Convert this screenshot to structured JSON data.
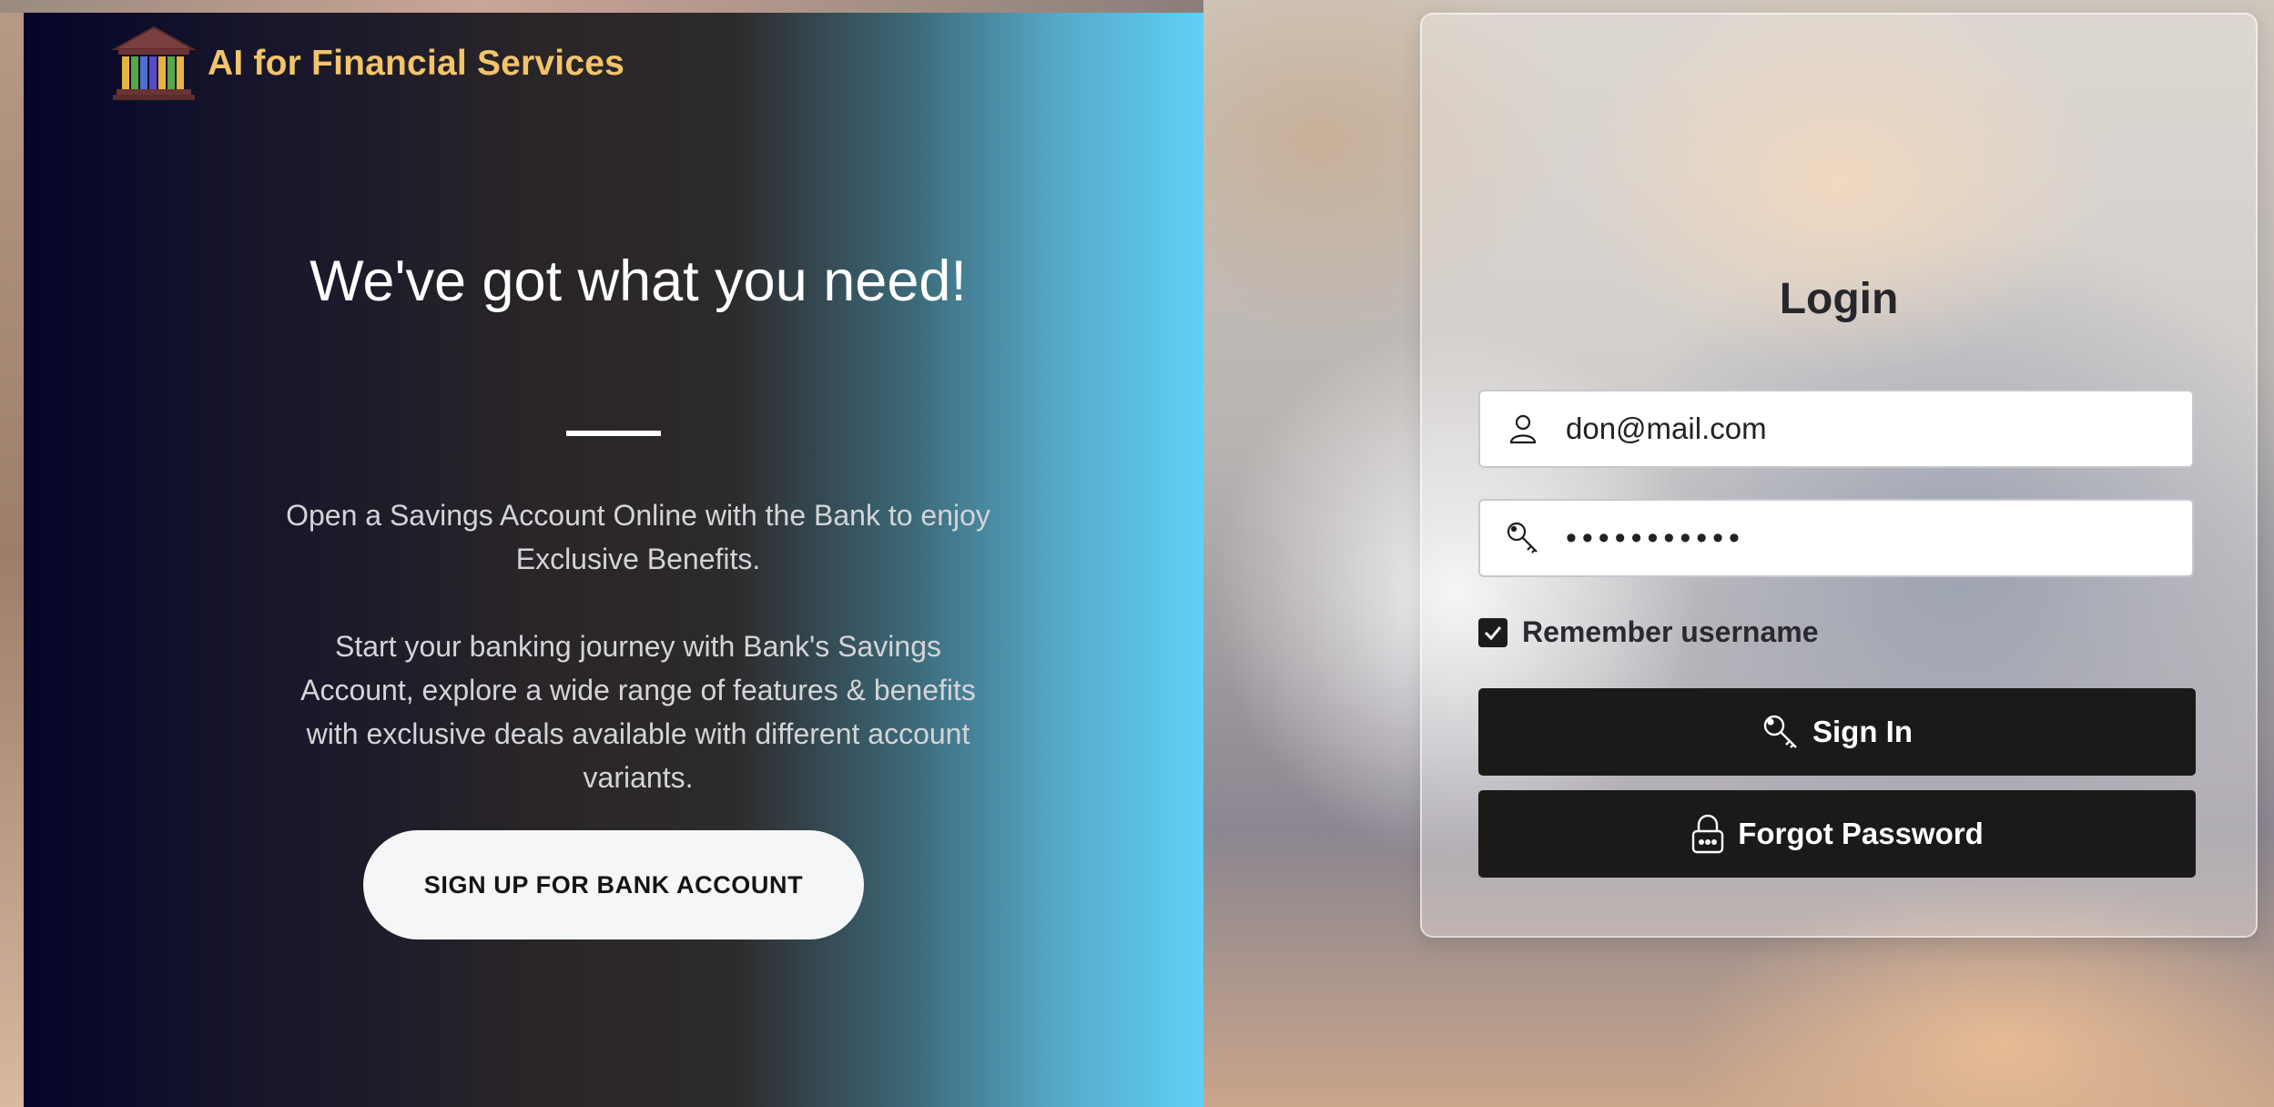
{
  "brand": {
    "name": "AI for Financial Services",
    "logo_icon": "bank-building-icon"
  },
  "hero": {
    "title": "We've got what you need!",
    "paragraph_1": "Open a Savings Account Online with the Bank to enjoy Exclusive Benefits.",
    "paragraph_2": "Start your banking journey with Bank's Savings Account, explore a wide range of features & benefits with exclusive deals available with different account variants.",
    "signup_button": "SIGN UP FOR BANK ACCOUNT"
  },
  "login": {
    "title": "Login",
    "username": {
      "value": "don@mail.com",
      "icon": "user-icon"
    },
    "password": {
      "value": "•••••••••••",
      "icon": "key-icon"
    },
    "remember": {
      "label": "Remember username",
      "checked": true
    },
    "sign_in_button": "Sign In",
    "sign_in_icon": "key-icon",
    "forgot_button": "Forgot Password",
    "forgot_icon": "lock-icon"
  },
  "colors": {
    "brand_accent": "#f2c46b",
    "button_dark": "#1b1a19",
    "hero_gradient_end": "#5fd0f7"
  }
}
